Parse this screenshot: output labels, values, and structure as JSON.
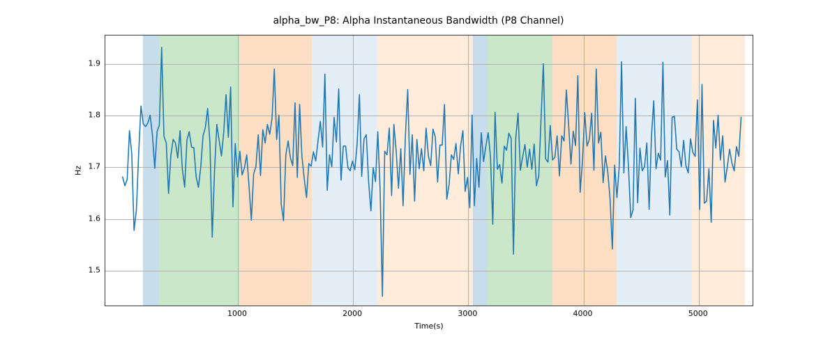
{
  "chart_data": {
    "type": "line",
    "title": "alpha_bw_P8: Alpha Instantaneous Bandwidth (P8 Channel)",
    "xlabel": "Time(s)",
    "ylabel": "Hz",
    "xlim": [
      -150,
      5480
    ],
    "ylim": [
      1.43,
      1.955
    ],
    "xticks": [
      1000,
      2000,
      3000,
      4000,
      5000
    ],
    "yticks": [
      1.5,
      1.6,
      1.7,
      1.8,
      1.9
    ],
    "grid": true,
    "bands": [
      {
        "x0": 175,
        "x1": 315,
        "color": "#1f77b4"
      },
      {
        "x0": 315,
        "x1": 1010,
        "color": "#2ca02c"
      },
      {
        "x0": 1010,
        "x1": 1640,
        "color": "#ff7f0e"
      },
      {
        "x0": 1640,
        "x1": 2210,
        "color": "#1f77b4",
        "alpha": 0.12
      },
      {
        "x0": 2210,
        "x1": 3040,
        "color": "#ff7f0e",
        "alpha": 0.15
      },
      {
        "x0": 3040,
        "x1": 3160,
        "color": "#1f77b4"
      },
      {
        "x0": 3160,
        "x1": 3730,
        "color": "#2ca02c"
      },
      {
        "x0": 3730,
        "x1": 4290,
        "color": "#ff7f0e"
      },
      {
        "x0": 4290,
        "x1": 4940,
        "color": "#1f77b4",
        "alpha": 0.12
      },
      {
        "x0": 4940,
        "x1": 5400,
        "color": "#ff7f0e",
        "alpha": 0.15
      }
    ],
    "series": [
      {
        "name": "alpha_bw_P8",
        "x_start": 0,
        "x_step": 20,
        "values": [
          1.68,
          1.663,
          1.675,
          1.77,
          1.725,
          1.576,
          1.615,
          1.725,
          1.818,
          1.783,
          1.778,
          1.785,
          1.8,
          1.761,
          1.697,
          1.768,
          1.781,
          1.932,
          1.759,
          1.746,
          1.648,
          1.722,
          1.753,
          1.746,
          1.717,
          1.77,
          1.695,
          1.66,
          1.752,
          1.768,
          1.738,
          1.737,
          1.68,
          1.66,
          1.699,
          1.76,
          1.776,
          1.813,
          1.746,
          1.563,
          1.693,
          1.782,
          1.751,
          1.721,
          1.767,
          1.84,
          1.757,
          1.855,
          1.622,
          1.745,
          1.68,
          1.73,
          1.684,
          1.698,
          1.723,
          1.662,
          1.596,
          1.686,
          1.7,
          1.762,
          1.683,
          1.772,
          1.746,
          1.782,
          1.763,
          1.794,
          1.89,
          1.753,
          1.8,
          1.627,
          1.595,
          1.723,
          1.75,
          1.717,
          1.702,
          1.824,
          1.679,
          1.821,
          1.72,
          1.677,
          1.64,
          1.706,
          1.701,
          1.729,
          1.711,
          1.75,
          1.788,
          1.738,
          1.88,
          1.654,
          1.723,
          1.7,
          1.796,
          1.748,
          1.851,
          1.674,
          1.74,
          1.74,
          1.698,
          1.692,
          1.711,
          1.694,
          1.744,
          1.84,
          1.681,
          1.754,
          1.762,
          1.671,
          1.614,
          1.698,
          1.671,
          1.768,
          1.655,
          1.448,
          1.73,
          1.723,
          1.775,
          1.644,
          1.782,
          1.73,
          1.658,
          1.735,
          1.624,
          1.76,
          1.85,
          1.685,
          1.762,
          1.633,
          1.753,
          1.696,
          1.735,
          1.692,
          1.775,
          1.721,
          1.702,
          1.773,
          1.758,
          1.67,
          1.742,
          1.742,
          1.821,
          1.637,
          1.665,
          1.723,
          1.714,
          1.745,
          1.686,
          1.74,
          1.77,
          1.652,
          1.679,
          1.62,
          1.8,
          1.624,
          1.716,
          1.66,
          1.766,
          1.71,
          1.74,
          1.766,
          1.72,
          1.588,
          1.806,
          1.695,
          1.704,
          1.668,
          1.74,
          1.732,
          1.765,
          1.755,
          1.53,
          1.756,
          1.804,
          1.693,
          1.719,
          1.743,
          1.699,
          1.734,
          1.695,
          1.744,
          1.663,
          1.682,
          1.794,
          1.9,
          1.715,
          1.709,
          1.78,
          1.713,
          1.718,
          1.76,
          1.682,
          1.76,
          1.75,
          1.849,
          1.78,
          1.705,
          1.769,
          1.741,
          1.877,
          1.65,
          1.71,
          1.805,
          1.74,
          1.753,
          1.804,
          1.693,
          1.89,
          1.746,
          1.767,
          1.669,
          1.721,
          1.69,
          1.638,
          1.54,
          1.703,
          1.64,
          1.7,
          1.904,
          1.688,
          1.778,
          1.701,
          1.601,
          1.616,
          1.833,
          1.63,
          1.736,
          1.692,
          1.7,
          1.746,
          1.617,
          1.758,
          1.828,
          1.696,
          1.726,
          1.713,
          1.903,
          1.68,
          1.712,
          1.606,
          1.796,
          1.798,
          1.734,
          1.729,
          1.7,
          1.751,
          1.702,
          1.688,
          1.754,
          1.728,
          1.72,
          1.83,
          1.617,
          1.86,
          1.629,
          1.633,
          1.696,
          1.592,
          1.79,
          1.736,
          1.8,
          1.713,
          1.76,
          1.67,
          1.7,
          1.734,
          1.707,
          1.692,
          1.739,
          1.72,
          1.796
        ]
      }
    ]
  }
}
